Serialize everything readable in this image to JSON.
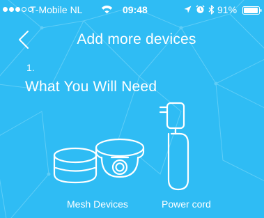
{
  "status_bar": {
    "carrier": "T-Mobile NL",
    "time": "09:48",
    "battery": "91%",
    "signal_bars_filled": 3,
    "signal_bars_total": 5,
    "icons": [
      "wifi-icon",
      "location-arrow-icon",
      "alarm-clock-icon",
      "bluetooth-icon",
      "battery-icon"
    ]
  },
  "nav": {
    "title": "Add more devices",
    "back_icon": "chevron-left-icon"
  },
  "content": {
    "step_number": "1.",
    "heading": "What You Will Need",
    "items": [
      {
        "label": "Mesh Devices",
        "icon": "mesh-devices-icon"
      },
      {
        "label": "Power cord",
        "icon": "power-cord-icon"
      }
    ]
  },
  "colors": {
    "background": "#2fbcf4",
    "foreground": "#ffffff",
    "pattern": "#5ccbf6"
  }
}
